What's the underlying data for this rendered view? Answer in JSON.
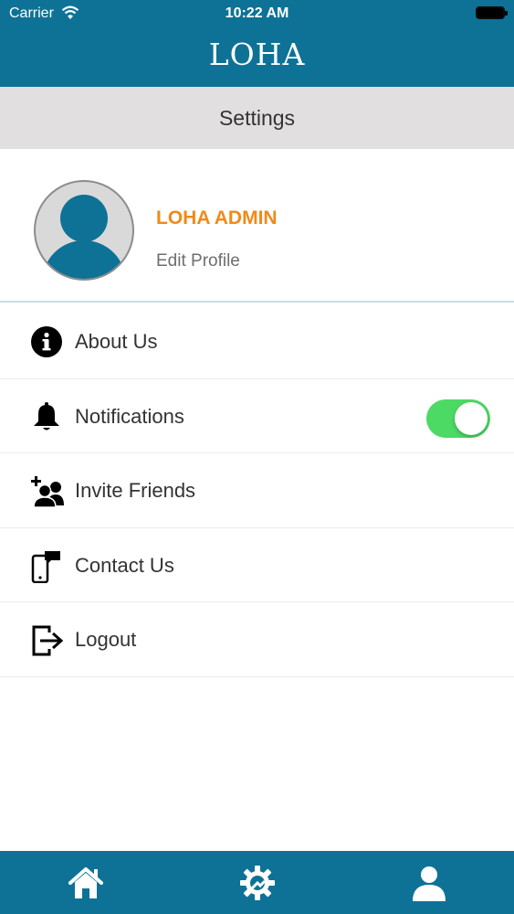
{
  "status_bar": {
    "carrier": "Carrier",
    "time": "10:22 AM"
  },
  "header": {
    "title": "LOHA"
  },
  "page": {
    "title": "Settings"
  },
  "profile": {
    "name": "LOHA ADMIN",
    "edit_label": "Edit Profile"
  },
  "menu": {
    "items": [
      {
        "label": "About Us",
        "icon": "info-icon"
      },
      {
        "label": "Notifications",
        "icon": "bell-icon",
        "toggle_on": true
      },
      {
        "label": "Invite Friends",
        "icon": "add-user-icon"
      },
      {
        "label": "Contact Us",
        "icon": "phone-chat-icon"
      },
      {
        "label": "Logout",
        "icon": "logout-icon"
      }
    ]
  },
  "tabbar": {
    "tabs": [
      {
        "icon": "home-icon"
      },
      {
        "icon": "settings-gear-icon",
        "active": true
      },
      {
        "icon": "profile-icon"
      }
    ]
  },
  "colors": {
    "header": "#0e7296",
    "subheader": "#e2dfe0",
    "profile_name": "#ef8a1a",
    "toggle_on": "#4cd964"
  }
}
